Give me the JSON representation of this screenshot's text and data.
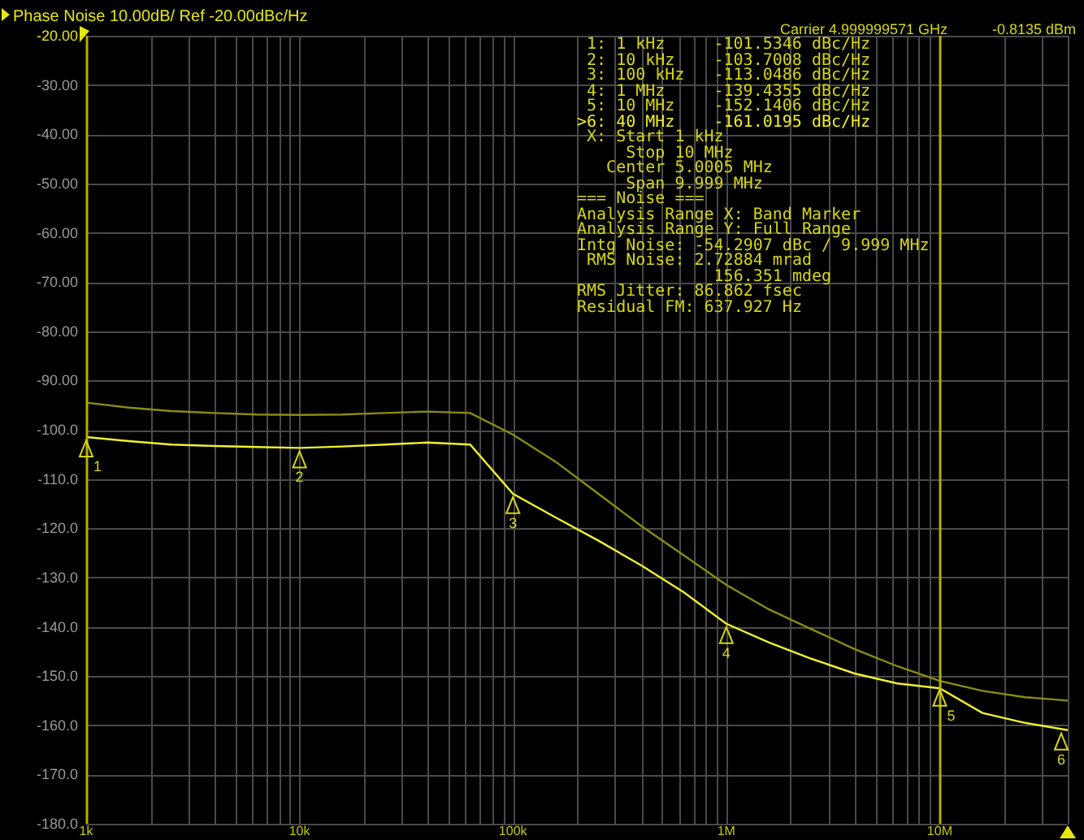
{
  "header": {
    "title": "Phase Noise 10.00dB/ Ref -20.00dBc/Hz",
    "carrier": "Carrier 4.999999571 GHz",
    "power": "-0.8135 dBm"
  },
  "marker_table": [
    {
      "index": "1:",
      "frequency": "1 kHz",
      "value": "-101.5346 dBc/Hz",
      "selected": false
    },
    {
      "index": "2:",
      "frequency": "10 kHz",
      "value": "-103.7008 dBc/Hz",
      "selected": false
    },
    {
      "index": "3:",
      "frequency": "100 kHz",
      "value": "-113.0486 dBc/Hz",
      "selected": false
    },
    {
      "index": "4:",
      "frequency": "1 MHz",
      "value": "-139.4355 dBc/Hz",
      "selected": false
    },
    {
      "index": "5:",
      "frequency": "10 MHz",
      "value": "-152.1406 dBc/Hz",
      "selected": false
    },
    {
      "index": ">6:",
      "frequency": "40 MHz",
      "value": "-161.0195 dBc/Hz",
      "selected": true
    }
  ],
  "info_lines": [
    {
      "kind": "axis",
      "text": "X: Start 1 kHz"
    },
    {
      "kind": "sweep",
      "text": "Stop 10 MHz"
    },
    {
      "kind": "center",
      "text": "Center 5.0005 MHz"
    },
    {
      "kind": "sweep",
      "text": "Span 9.999 MHz"
    },
    {
      "kind": "line",
      "text": "=== Noise ==="
    },
    {
      "kind": "line",
      "text": "Analysis Range X: Band Marker"
    },
    {
      "kind": "line",
      "text": "Analysis Range Y: Full Range"
    },
    {
      "kind": "line",
      "text": "Intg Noise: -54.2907 dBc / 9.999 MHz"
    },
    {
      "kind": "sub",
      "text": "RMS Noise: 2.72884 mrad"
    },
    {
      "kind": "continuation",
      "text": "156.351 mdeg"
    },
    {
      "kind": "line",
      "text": "RMS Jitter: 86.862 fsec"
    },
    {
      "kind": "line",
      "text": "Residual FM: 637.927 Hz"
    }
  ],
  "chart_data": {
    "type": "line",
    "grid": true,
    "ylim": [
      -180,
      -20
    ],
    "categories": [
      "1k",
      null,
      null,
      null,
      null,
      "10k",
      null,
      null,
      null,
      null,
      "100k",
      null,
      null,
      null,
      null,
      "1M",
      null,
      null,
      null,
      null,
      "10M",
      null,
      null,
      null
    ],
    "series": [
      {
        "color": "#f0f030",
        "values": [
          -101.5,
          -102.3,
          -103,
          -103.3,
          -103.5,
          -103.7,
          -103.4,
          -103,
          -102.6,
          -103,
          -113,
          -117.8,
          -122.5,
          -127.5,
          -133,
          -139.4,
          -143.2,
          -146.5,
          -149.5,
          -151.5,
          -152.5,
          -157.5,
          -159.5,
          -161
        ]
      },
      {
        "color": "#8c8c10",
        "values": [
          -94.5,
          -95.5,
          -96.2,
          -96.6,
          -96.9,
          -97,
          -96.9,
          -96.6,
          -96.3,
          -96.6,
          -101,
          -106.5,
          -113,
          -119.5,
          -125.5,
          -131.5,
          -136.5,
          -140.5,
          -144.5,
          -148,
          -151,
          -153,
          -154.3,
          -155
        ]
      }
    ],
    "yticks": [
      {
        "value": -20,
        "label": "-20.00"
      },
      {
        "value": -30,
        "label": "-30.00"
      },
      {
        "value": -40,
        "label": "-40.00"
      },
      {
        "value": -50,
        "label": "-50.00"
      },
      {
        "value": -60,
        "label": "-60.00"
      },
      {
        "value": -70,
        "label": "-70.00"
      },
      {
        "value": -80,
        "label": "-80.00"
      },
      {
        "value": -90,
        "label": "-90.00"
      },
      {
        "value": -100,
        "label": "-100.0"
      },
      {
        "value": -110,
        "label": "-110.0"
      },
      {
        "value": -120,
        "label": "-120.0"
      },
      {
        "value": -130,
        "label": "-130.0"
      },
      {
        "value": -140,
        "label": "-140.0"
      },
      {
        "value": -150,
        "label": "-150.0"
      },
      {
        "value": -160,
        "label": "-160.0"
      },
      {
        "value": -170,
        "label": "-170.0"
      },
      {
        "value": -180,
        "label": "-180.0"
      }
    ],
    "ref_lines": [
      {
        "axis": "x",
        "value": "10M"
      }
    ],
    "annotations": [
      {
        "text": "1",
        "x": "1k",
        "y": -101.5
      },
      {
        "text": "2",
        "x": "10k",
        "y": -103.7
      },
      {
        "text": "3",
        "x": "100k",
        "y": -113
      },
      {
        "text": "4",
        "x": "1M",
        "y": -139.4
      },
      {
        "text": "5",
        "x": "10M",
        "y": -152.1
      },
      {
        "text": "6",
        "y": -161
      }
    ]
  }
}
